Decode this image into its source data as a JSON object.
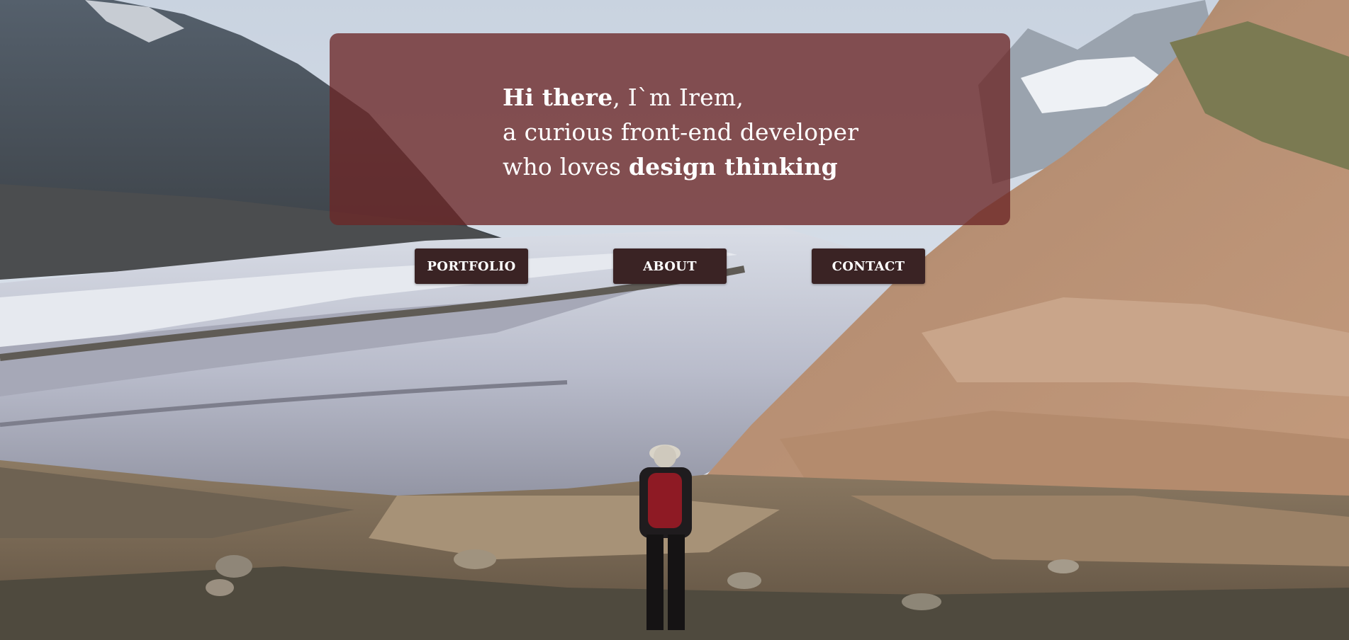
{
  "hero": {
    "line1_bold": "Hi there",
    "line1_rest": ", I`m Irem,",
    "line2": "a curious front-end developer",
    "line3_prefix": "who loves ",
    "line3_bold": "design thinking"
  },
  "nav": {
    "items": [
      {
        "label": "PORTFOLIO"
      },
      {
        "label": "ABOUT"
      },
      {
        "label": "CONTACT"
      }
    ]
  },
  "colors": {
    "card": "#6c2626",
    "button": "#3a2324",
    "text": "#ffffff"
  }
}
